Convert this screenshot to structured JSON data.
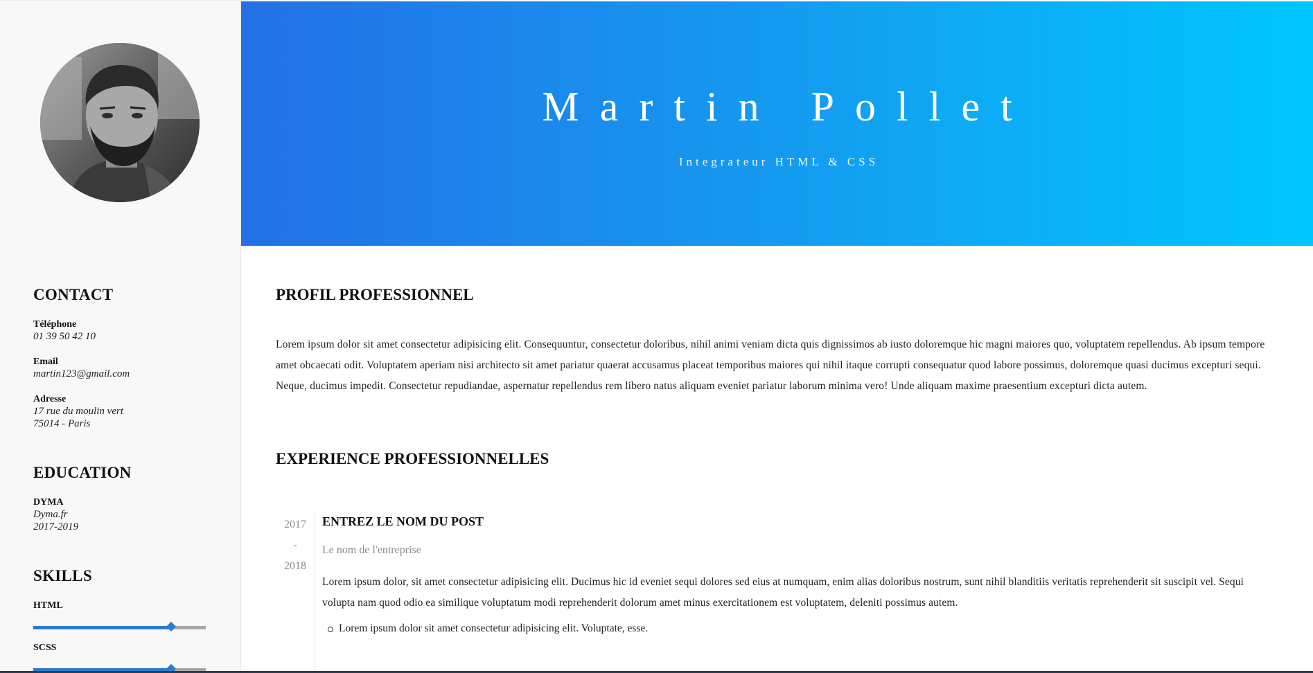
{
  "sidebar": {
    "avatar_alt": "Photo de profil",
    "contact": {
      "title": "CONTACT",
      "phone_label": "Téléphone",
      "phone_value": "01 39 50 42 10",
      "email_label": "Email",
      "email_value": "martin123@gmail.com",
      "address_label": "Adresse",
      "address_line1": "17 rue du moulin vert",
      "address_line2": "75014 - Paris"
    },
    "education": {
      "title": "EDUCATION",
      "school": "DYMA",
      "site": "Dyma.fr",
      "years": "2017-2019"
    },
    "skills": {
      "title": "SKILLS",
      "items": [
        {
          "name": "HTML",
          "level": 0.8
        },
        {
          "name": "SCSS",
          "level": 0.8
        }
      ]
    }
  },
  "header": {
    "name": "Martin Pollet",
    "subtitle": "Integrateur HTML & CSS",
    "gradient_start": "#2370e6",
    "gradient_end": "#00c6ff"
  },
  "main": {
    "profile": {
      "title": "PROFIL PROFESSIONNEL",
      "text": "Lorem ipsum dolor sit amet consectetur adipisicing elit. Consequuntur, consectetur doloribus, nihil animi veniam dicta quis dignissimos ab iusto doloremque hic magni maiores quo, voluptatem repellendus. Ab ipsum tempore amet obcaecati odit. Voluptatem aperiam nisi architecto sit amet pariatur quaerat accusamus placeat temporibus maiores qui nihil itaque corrupti consequatur quod labore possimus, doloremque quasi ducimus excepturi sequi. Neque, ducimus impedit. Consectetur repudiandae, aspernatur repellendus rem libero natus aliquam eveniet pariatur laborum minima vero! Unde aliquam maxime praesentium excepturi dicta autem."
    },
    "experience": {
      "title": "EXPERIENCE PROFESSIONNELLES",
      "items": [
        {
          "start": "2017",
          "separator": "-",
          "end": "2018",
          "post": "ENTREZ LE NOM DU POST",
          "company": "Le nom de l'entreprise",
          "description": "Lorem ipsum dolor, sit amet consectetur adipisicing elit. Ducimus hic id eveniet sequi dolores sed eius at numquam, enim alias doloribus nostrum, sunt nihil blanditiis veritatis reprehenderit sit suscipit vel. Sequi volupta nam quod odio ea similique voluptatum modi reprehenderit dolorum amet minus exercitationem est voluptatem, deleniti possimus autem.",
          "bullets": [
            "Lorem ipsum dolor sit amet consectetur adipisicing elit. Voluptate, esse."
          ]
        }
      ]
    }
  },
  "colors": {
    "accent": "#2b7bd0",
    "skill_track": "#a6a6a6",
    "sidebar_bg": "#f8f8f8"
  }
}
